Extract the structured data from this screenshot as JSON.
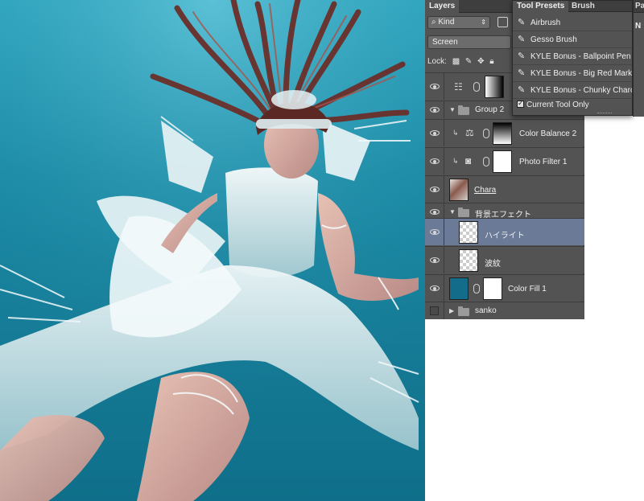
{
  "layers_panel": {
    "tab_label": "Layers",
    "kind_label": "Kind",
    "blend_mode": "Screen",
    "lock_label": "Lock:",
    "layers": [
      {
        "name": "",
        "visible": true
      },
      {
        "name": "Group 2",
        "visible": true
      },
      {
        "name": "Color Balance 2",
        "visible": true
      },
      {
        "name": "Photo Filter 1",
        "visible": true
      },
      {
        "name": "Chara",
        "visible": true
      },
      {
        "name": "背景エフェクト",
        "visible": true
      },
      {
        "name": "ハイライト",
        "visible": true,
        "selected": true
      },
      {
        "name": "波紋",
        "visible": true
      },
      {
        "name": "Color Fill 1",
        "visible": true
      },
      {
        "name": "sanko",
        "visible": false
      }
    ]
  },
  "tool_presets": {
    "tab_label": "Tool Presets",
    "other_tab_label": "Brush",
    "items": [
      "Airbrush",
      "Gesso Brush",
      "KYLE Bonus - Ballpoint Pen",
      "KYLE Bonus - Big Red Marker",
      "KYLE Bonus - Chunky Charcoal"
    ],
    "current_tool_only_label": "Current Tool Only"
  },
  "paragraph_panel": {
    "tab_label": "Pa",
    "first_label": "N"
  },
  "colors": {
    "panel_bg": "#535353",
    "tab_bar_bg": "#3e3e3e",
    "selected_layer": "#6b7a96",
    "water_teal": "#1b8aa5"
  }
}
